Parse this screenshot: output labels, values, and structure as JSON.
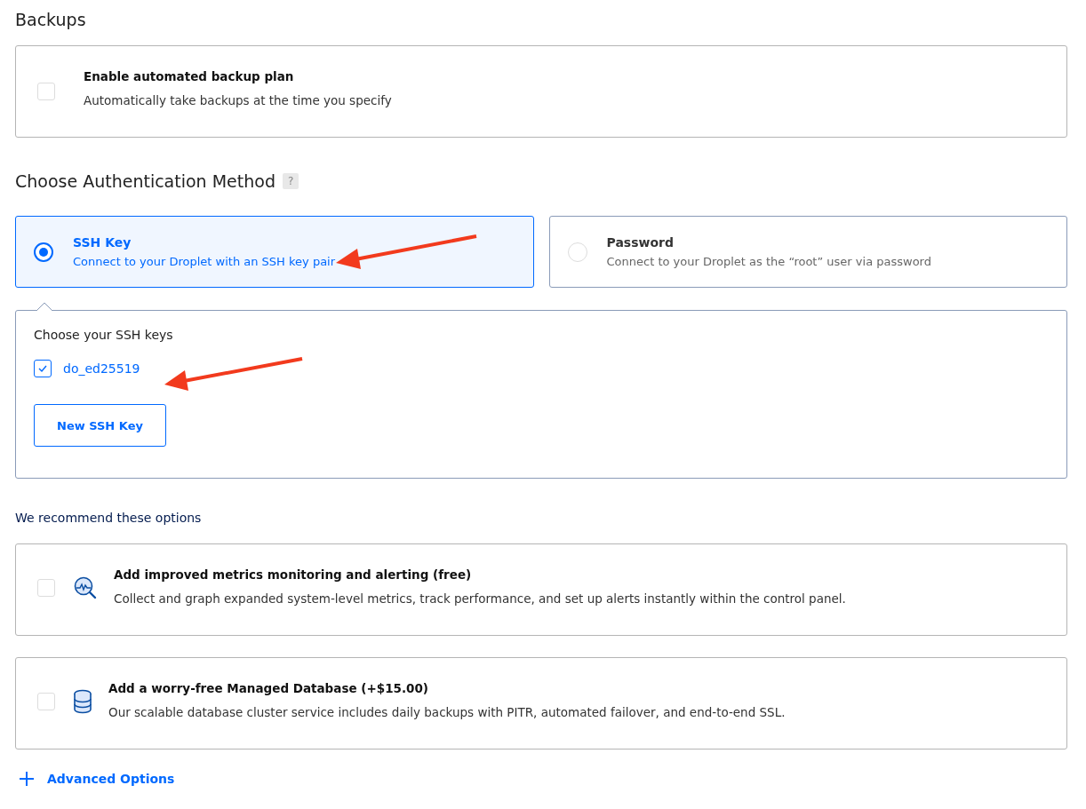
{
  "backups": {
    "title": "Backups",
    "option": {
      "checked": false,
      "title": "Enable automated backup plan",
      "description": "Automatically take backups at the time you specify"
    }
  },
  "auth": {
    "title": "Choose Authentication Method",
    "help": "?",
    "methods": [
      {
        "title": "SSH Key",
        "description": "Connect to your Droplet with an SSH key pair",
        "selected": true
      },
      {
        "title": "Password",
        "description": "Connect to your Droplet as the “root” user via password",
        "selected": false
      }
    ],
    "keys_label": "Choose your SSH keys",
    "keys": [
      {
        "name": "do_ed25519",
        "checked": true
      }
    ],
    "new_key_button": "New SSH Key"
  },
  "recommend": {
    "title": "We recommend these options",
    "options": [
      {
        "kind": "metrics",
        "checked": false,
        "title": "Add improved metrics monitoring and alerting (free)",
        "description": "Collect and graph expanded system-level metrics, track performance, and set up alerts instantly within the control panel."
      },
      {
        "kind": "database",
        "checked": false,
        "title": "Add a worry-free Managed Database (+$15.00)",
        "description": "Our scalable database cluster service includes daily backups with PITR, automated failover, and end-to-end SSL."
      }
    ]
  },
  "advanced_link": "Advanced Options"
}
